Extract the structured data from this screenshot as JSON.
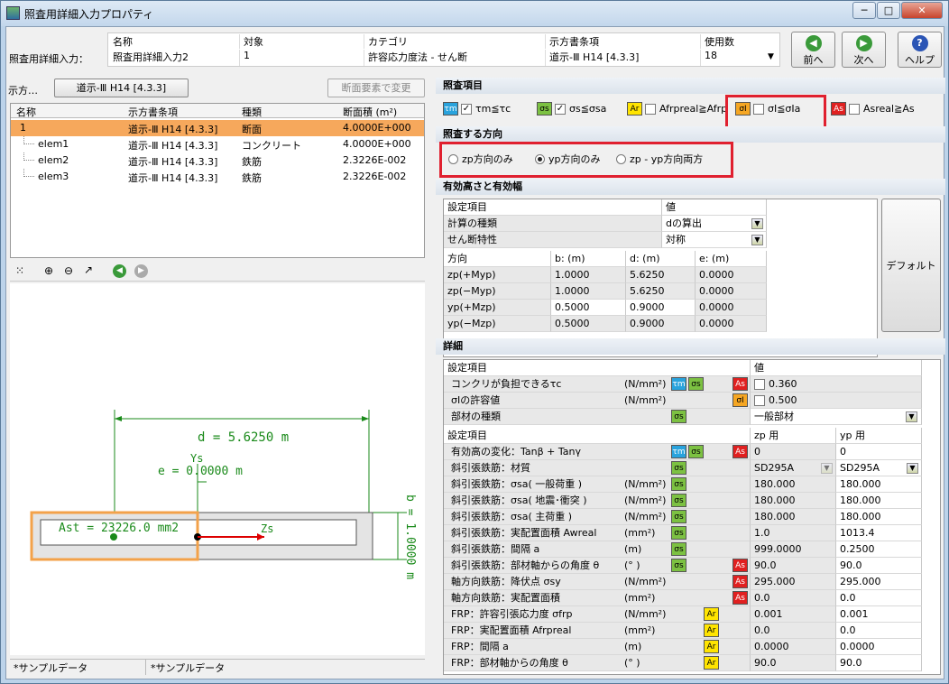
{
  "window": {
    "title": "照査用詳細入力プロパティ",
    "min": "─",
    "max": "□",
    "close": "✕"
  },
  "top": {
    "row_label": "照査用詳細入力：",
    "headers": [
      "名称",
      "対象",
      "カテゴリ",
      "示方書条項",
      "使用数"
    ],
    "values": [
      "照査用詳細入力2",
      "1",
      "許容応力度法 - せん断",
      "道示-Ⅲ H14 [4.3.3]",
      "18"
    ]
  },
  "nav": {
    "prev": "前へ",
    "next": "次へ",
    "help": "ヘルプ"
  },
  "left": {
    "spec_label": "示方…",
    "spec_button": "道示-Ⅲ H14 [4.3.3]",
    "change_button": "断面要素で変更",
    "columns": [
      "名称",
      "示方書条項",
      "種類",
      "断面積 (m²)"
    ],
    "rows": [
      [
        "1",
        "道示-Ⅲ H14 [4.3.3]",
        "断面",
        "4.0000E+000"
      ],
      [
        "elem1",
        "道示-Ⅲ H14 [4.3.3]",
        "コンクリート",
        "4.0000E+000"
      ],
      [
        "elem2",
        "道示-Ⅲ H14 [4.3.3]",
        "鉄筋",
        "2.3226E-002"
      ],
      [
        "elem3",
        "道示-Ⅲ H14 [4.3.3]",
        "鉄筋",
        "2.3226E-002"
      ]
    ],
    "drawing": {
      "d_label": "d = 5.6250 m",
      "e_label": "e = 0.0000 m",
      "ys_label": "Ys",
      "zs_label": "Zs",
      "ast_label": "Ast = 23226.0 mm2",
      "b_label": "b = 1.0000 m"
    },
    "status": [
      "*サンプルデータ",
      "*サンプルデータ"
    ]
  },
  "check": {
    "section_title": "照査項目",
    "items": [
      {
        "tag": "τm",
        "text": "τm≦τc",
        "checked": true
      },
      {
        "tag": "σs",
        "text": "σs≦σsa",
        "checked": true
      },
      {
        "tag": "Ar",
        "text": "Afrpreal≧Afrp",
        "checked": false
      },
      {
        "tag": "σI",
        "text": "σI≦σIa",
        "checked": false
      },
      {
        "tag": "As",
        "text": "Asreal≧As",
        "checked": false
      }
    ]
  },
  "direction": {
    "section_title": "照査する方向",
    "options": [
      "zp方向のみ",
      "yp方向のみ",
      "zp - yp方向両方"
    ],
    "selected": 1
  },
  "height": {
    "section_title": "有効高さと有効幅",
    "settings_header": [
      "設定項目",
      "値"
    ],
    "settings": [
      [
        "計算の種類",
        "dの算出"
      ],
      [
        "せん断特性",
        "対称"
      ]
    ],
    "dir_header": [
      "方向",
      "b: (m)",
      "d: (m)",
      "e: (m)"
    ],
    "dir_rows": [
      [
        "zp(+Myp)",
        "1.0000",
        "5.6250",
        "0.0000"
      ],
      [
        "zp(−Myp)",
        "1.0000",
        "5.6250",
        "0.0000"
      ],
      [
        "yp(+Mzp)",
        "0.5000",
        "0.9000",
        "0.0000"
      ],
      [
        "yp(−Mzp)",
        "0.5000",
        "0.9000",
        "0.0000"
      ]
    ],
    "default_button": "デフォルト"
  },
  "detail": {
    "section_title": "詳細",
    "header1": [
      "設定項目",
      "値"
    ],
    "rows1": [
      {
        "name": "コンクリが負担できるτc",
        "unit": "(N/mm²)",
        "tags": [
          "τm",
          "σs"
        ],
        "tag2": "As",
        "v": "0.360",
        "cb": true
      },
      {
        "name": "σIの許容値",
        "unit": "(N/mm²)",
        "tags": [],
        "tag2": "σI",
        "v": "0.500",
        "cb": true
      },
      {
        "name": "部材の種類",
        "unit": "",
        "tags": [
          "σs"
        ],
        "tag2": "",
        "v": "一般部材",
        "cb": false
      }
    ],
    "header2": [
      "設定項目",
      "zp 用",
      "yp 用"
    ],
    "rows2": [
      {
        "name": "有効高の変化：Tanβ + Tanγ",
        "unit": "",
        "tags": [
          "τm",
          "σs"
        ],
        "tag2": "As",
        "zp": "0",
        "yp": "0"
      },
      {
        "name": "斜引張鉄筋：材質",
        "unit": "",
        "tags": [
          "σs"
        ],
        "tag2": "",
        "zp": "SD295A",
        "yp": "SD295A"
      },
      {
        "name": "斜引張鉄筋：σsa( 一般荷重 )",
        "unit": "(N/mm²)",
        "tags": [
          "σs"
        ],
        "tag2": "",
        "zp": "180.000",
        "yp": "180.000"
      },
      {
        "name": "斜引張鉄筋：σsa( 地震･衝突 )",
        "unit": "(N/mm²)",
        "tags": [
          "σs"
        ],
        "tag2": "",
        "zp": "180.000",
        "yp": "180.000"
      },
      {
        "name": "斜引張鉄筋：σsa( 主荷重 )",
        "unit": "(N/mm²)",
        "tags": [
          "σs"
        ],
        "tag2": "",
        "zp": "180.000",
        "yp": "180.000"
      },
      {
        "name": "斜引張鉄筋：実配置面積 Awreal",
        "unit": "(mm²)",
        "tags": [
          "σs"
        ],
        "tag2": "",
        "zp": "1.0",
        "yp": "1013.4"
      },
      {
        "name": "斜引張鉄筋：間隔 a",
        "unit": "(m)",
        "tags": [
          "σs"
        ],
        "tag2": "",
        "zp": "999.0000",
        "yp": "0.2500"
      },
      {
        "name": "斜引張鉄筋：部材軸からの角度 θ",
        "unit": "(° )",
        "tags": [
          "σs"
        ],
        "tag2": "As",
        "zp": "90.0",
        "yp": "90.0"
      },
      {
        "name": "軸方向鉄筋：降伏点 σsy",
        "unit": "(N/mm²)",
        "tags": [],
        "tag2": "As",
        "zp": "295.000",
        "yp": "295.000"
      },
      {
        "name": "軸方向鉄筋：実配置面積",
        "unit": "(mm²)",
        "tags": [],
        "tag2": "As",
        "zp": "0.0",
        "yp": "0.0"
      },
      {
        "name": "FRP：許容引張応力度 σfrp",
        "unit": "(N/mm²)",
        "tags": [
          "Ar"
        ],
        "tag2": "",
        "zp": "0.001",
        "yp": "0.001"
      },
      {
        "name": "FRP：実配置面積 Afrpreal",
        "unit": "(mm²)",
        "tags": [
          "Ar"
        ],
        "tag2": "",
        "zp": "0.0",
        "yp": "0.0"
      },
      {
        "name": "FRP：間隔 a",
        "unit": "(m)",
        "tags": [
          "Ar"
        ],
        "tag2": "",
        "zp": "0.0000",
        "yp": "0.0000"
      },
      {
        "name": "FRP：部材軸からの角度 θ",
        "unit": "(° )",
        "tags": [
          "Ar"
        ],
        "tag2": "",
        "zp": "90.0",
        "yp": "90.0"
      }
    ]
  }
}
